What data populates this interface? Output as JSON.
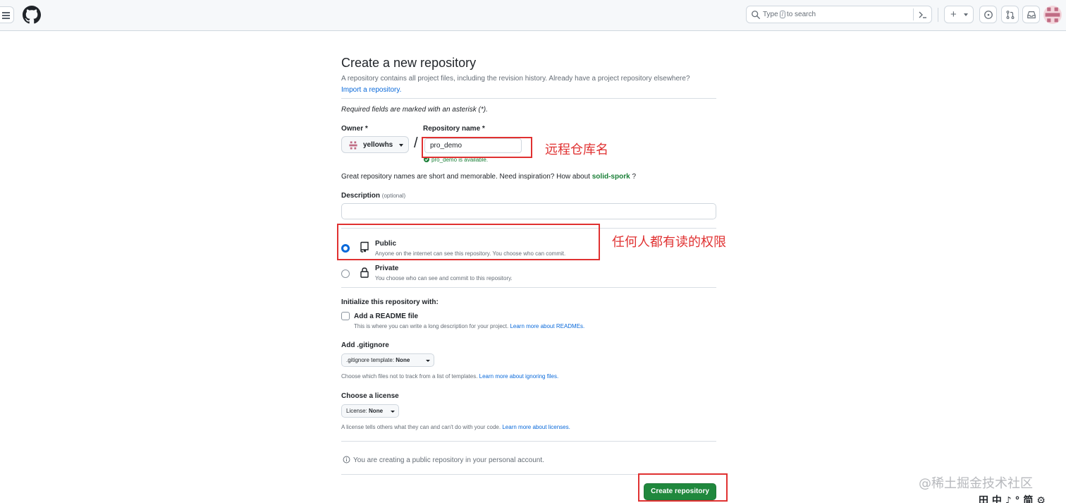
{
  "header": {
    "search_placeholder_before": "Type",
    "search_key": "/",
    "search_placeholder_after": "to search",
    "new_button_label": "+"
  },
  "page": {
    "title": "Create a new repository",
    "description": "A repository contains all project files, including the revision history. Already have a project repository elsewhere?",
    "import_link": "Import a repository.",
    "required_note": "Required fields are marked with an asterisk (*)."
  },
  "owner": {
    "label": "Owner *",
    "value": "yellowhs"
  },
  "repo_name": {
    "label": "Repository name *",
    "value": "pro_demo",
    "availability": "pro_demo is available."
  },
  "inspiration": {
    "text": "Great repository names are short and memorable. Need inspiration? How about",
    "suggestion": "solid-spork",
    "suffix": "?"
  },
  "description_field": {
    "label": "Description",
    "optional": "(optional)",
    "value": ""
  },
  "visibility": {
    "public": {
      "title": "Public",
      "subtitle": "Anyone on the internet can see this repository. You choose who can commit.",
      "selected": true
    },
    "private": {
      "title": "Private",
      "subtitle": "You choose who can see and commit to this repository.",
      "selected": false
    }
  },
  "initialize": {
    "heading": "Initialize this repository with:",
    "readme_label": "Add a README file",
    "readme_help": "This is where you can write a long description for your project.",
    "readme_link": "Learn more about READMEs.",
    "readme_checked": false
  },
  "gitignore": {
    "heading": "Add .gitignore",
    "select_prefix": ".gitignore template:",
    "select_value": "None",
    "help": "Choose which files not to track from a list of templates.",
    "link": "Learn more about ignoring files."
  },
  "license": {
    "heading": "Choose a license",
    "select_prefix": "License:",
    "select_value": "None",
    "help": "A license tells others what they can and can't do with your code.",
    "link": "Learn more about licenses."
  },
  "footer": {
    "info": "You are creating a public repository in your personal account.",
    "create_button": "Create repository"
  },
  "annotations": {
    "repo_name_note": "远程仓库名",
    "public_note": "任何人都有读的权限"
  },
  "overlay": {
    "watermark": "@稀土掘金技术社区",
    "ime_toolbar": "田 中 ♪ ° 简 ⚙"
  },
  "colors": {
    "accent": "#0969da",
    "success": "#1a7f37",
    "primary_button": "#1f883d",
    "annotation_red": "#e03131"
  }
}
